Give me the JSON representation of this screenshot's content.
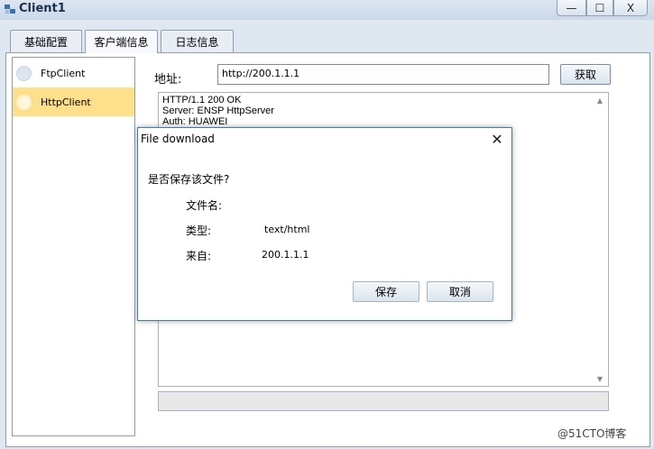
{
  "window": {
    "title": "Client1",
    "minimize_glyph": "—",
    "maximize_glyph": "☐",
    "close_glyph": "X"
  },
  "tabs": [
    {
      "label": "基础配置"
    },
    {
      "label": "客户端信息"
    },
    {
      "label": "日志信息"
    }
  ],
  "clients": [
    {
      "label": "FtpClient"
    },
    {
      "label": "HttpClient"
    }
  ],
  "address": {
    "label": "地址:",
    "value": "http://200.1.1.1",
    "fetch_label": "获取"
  },
  "response": {
    "text": "HTTP/1.1 200 OK\nServer: ENSP HttpServer\nAuth: HUAWEI"
  },
  "dialog": {
    "title": "File download",
    "question": "是否保存该文件?",
    "filename_label": "文件名:",
    "filename_value": "",
    "type_label": "类型:",
    "type_value": "text/html",
    "from_label": "来自:",
    "from_value": "200.1.1.1",
    "save_label": "保存",
    "cancel_label": "取消"
  },
  "watermark": "@51CTO博客"
}
